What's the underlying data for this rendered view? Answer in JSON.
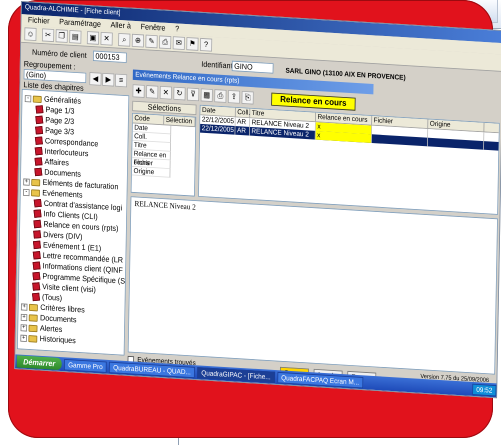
{
  "window": {
    "title": "Quadra-ALCHIMIE - [Fiche client]"
  },
  "menu": [
    "Fichier",
    "Paramétrage",
    "Aller à",
    "Fenêtre",
    "?"
  ],
  "client": {
    "numero_label": "Numéro de client",
    "numero_value": "000153",
    "identifiant_label": "Identifiant",
    "identifiant_value": "GINO",
    "regroupement_label": "Regroupement :",
    "regroupement_value": "(Gino)",
    "raison": "SARL GINO (13100 AIX EN PROVENCE)"
  },
  "chapters": {
    "label": "Liste des chapitres",
    "items": [
      {
        "text": "Généralités",
        "level": 0,
        "type": "folder",
        "exp": "-"
      },
      {
        "text": "Page 1/3",
        "level": 1,
        "type": "page"
      },
      {
        "text": "Page 2/3",
        "level": 1,
        "type": "page"
      },
      {
        "text": "Page 3/3",
        "level": 1,
        "type": "page"
      },
      {
        "text": "Correspondance",
        "level": 1,
        "type": "page"
      },
      {
        "text": "Interlocuteurs",
        "level": 1,
        "type": "page"
      },
      {
        "text": "Affaires",
        "level": 1,
        "type": "page"
      },
      {
        "text": "Documents",
        "level": 1,
        "type": "page"
      },
      {
        "text": "Eléments de facturation",
        "level": 0,
        "type": "folder",
        "exp": "+"
      },
      {
        "text": "Evénements",
        "level": 0,
        "type": "folder",
        "exp": "-"
      },
      {
        "text": "Contrat d'assistance logi",
        "level": 1,
        "type": "page"
      },
      {
        "text": "Info Clients (CLI)",
        "level": 1,
        "type": "page"
      },
      {
        "text": "Relance en cours (rpts)",
        "level": 1,
        "type": "page"
      },
      {
        "text": "Divers (DIV)",
        "level": 1,
        "type": "page"
      },
      {
        "text": "Evénement 1 (E1)",
        "level": 1,
        "type": "page"
      },
      {
        "text": "Lettre recommandée (LR",
        "level": 1,
        "type": "page"
      },
      {
        "text": "Informations client (QINF",
        "level": 1,
        "type": "page"
      },
      {
        "text": "Programme Spécifique (S",
        "level": 1,
        "type": "page"
      },
      {
        "text": "Visite client (visi)",
        "level": 1,
        "type": "page"
      },
      {
        "text": "(Tous)",
        "level": 1,
        "type": "page"
      },
      {
        "text": "Critères libres",
        "level": 0,
        "type": "folder",
        "exp": "+"
      },
      {
        "text": "Documents",
        "level": 0,
        "type": "folder",
        "exp": "+"
      },
      {
        "text": "Alertes",
        "level": 0,
        "type": "folder",
        "exp": "+"
      },
      {
        "text": "Historiques",
        "level": 0,
        "type": "folder",
        "exp": "+"
      }
    ]
  },
  "panel": {
    "title": "Evénements Relance en cours (rpts)",
    "relance_label": "Relance en cours"
  },
  "selections": {
    "title": "Sélections",
    "headers": [
      "Code",
      "Sélection"
    ],
    "rows": [
      "Date",
      "Coll.",
      "Titre",
      "Relance en cours",
      "Fichier",
      "Origine"
    ]
  },
  "events": {
    "headers": [
      "Date",
      "Coll.",
      "Titre",
      "Relance en cours",
      "Fichier",
      "Origine"
    ],
    "rows": [
      {
        "date": "22/12/2005",
        "coll": "AR",
        "titre": "RELANCE Niveau 2",
        "relance": "x",
        "fichier": "",
        "origine": ""
      },
      {
        "date": "22/12/2005",
        "coll": "AR",
        "titre": "RELANCE Niveau 2",
        "relance": "x",
        "fichier": "",
        "origine": ""
      }
    ]
  },
  "memo": {
    "text": "RELANCE Niveau 2"
  },
  "bottom": {
    "checkbox_label": "Evénements trouvés",
    "save_label": "Sauver",
    "cancel_label": "Annuler",
    "close_label": "Fermer",
    "version": "Version 7.75 du 25/09/2006"
  },
  "taskbar": {
    "start": "Démarrer",
    "tasks": [
      "Gamme Pro",
      "QuadraBUREAU - QUAD...",
      "QuadraGIPAC - [Fiche...",
      "QuadraFACPAQ Ecran M..."
    ],
    "clock": "09:52"
  }
}
